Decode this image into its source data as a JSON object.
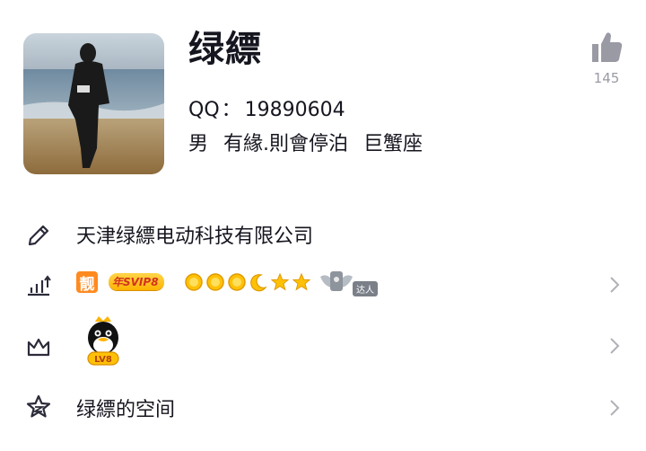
{
  "profile": {
    "nickname": "绿縹",
    "qq_label": "QQ",
    "qq_colon": "：",
    "qq_number": "19890604",
    "gender": "男",
    "signature": "有緣.則會停泊",
    "zodiac": "巨蟹座",
    "avatar_icon": "beach-photo-avatar"
  },
  "like": {
    "icon": "thumbs-up-icon",
    "count": "145"
  },
  "rows": {
    "company": {
      "icon": "pencil-icon",
      "text": "天津绿縹电动科技有限公司"
    },
    "badges": {
      "icon": "level-up-icon",
      "hao_badge": "靓",
      "svip_badge": "年SVIP8",
      "level_icons": [
        "sun-icon",
        "sun-icon",
        "sun-icon",
        "moon-icon",
        "star-icon",
        "star-icon"
      ],
      "daren_badge": "达人"
    },
    "qq_level": {
      "icon": "crown-icon",
      "penguin_level": "LV8"
    },
    "space": {
      "icon": "star-space-icon",
      "text": "绿縹的空间"
    }
  },
  "colors": {
    "accent_orange": "#ff8a1f",
    "gold": "#ffc107",
    "text": "#15161f",
    "muted": "#9a9aa5"
  }
}
